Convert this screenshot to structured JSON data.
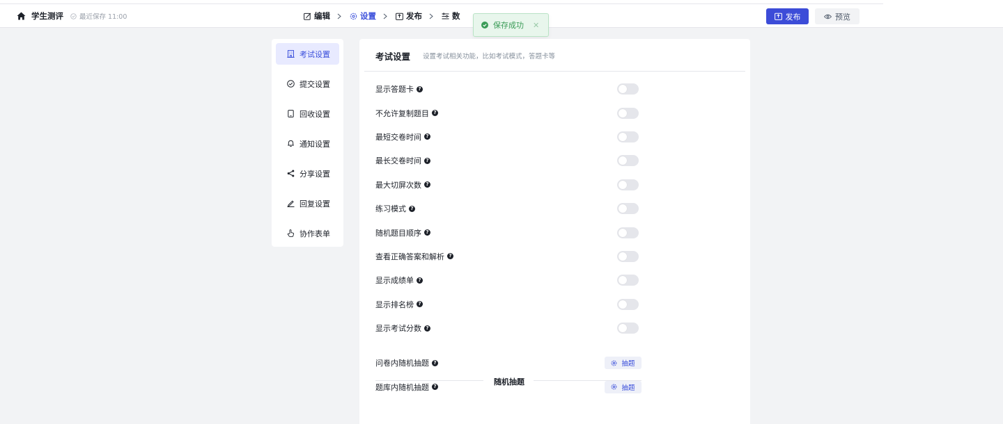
{
  "header": {
    "title": "学生测评",
    "save_status": "最近保存 11:00",
    "steps": [
      {
        "label": "编辑",
        "icon": "edit-icon"
      },
      {
        "label": "设置",
        "icon": "gear-icon"
      },
      {
        "label": "发布",
        "icon": "share-box-icon"
      },
      {
        "label": "数",
        "icon": "list-settings-icon"
      }
    ],
    "publish_label": "发布",
    "preview_label": "预览"
  },
  "toast": {
    "message": "保存成功"
  },
  "sidebar": {
    "items": [
      {
        "label": "考试设置",
        "icon": "building-icon"
      },
      {
        "label": "提交设置",
        "icon": "check-circle-icon"
      },
      {
        "label": "回收设置",
        "icon": "tablet-icon"
      },
      {
        "label": "通知设置",
        "icon": "bell-icon"
      },
      {
        "label": "分享设置",
        "icon": "share-icon"
      },
      {
        "label": "回复设置",
        "icon": "pen-icon"
      },
      {
        "label": "协作表单",
        "icon": "hand-pointer-icon"
      }
    ]
  },
  "panel": {
    "title": "考试设置",
    "subtitle": "设置考试相关功能，比如考试模式，答题卡等",
    "settings": [
      {
        "label": "显示答题卡",
        "enabled": false
      },
      {
        "label": "不允许复制题目",
        "enabled": false
      },
      {
        "label": "最短交卷时间",
        "enabled": false
      },
      {
        "label": "最长交卷时间",
        "enabled": false
      },
      {
        "label": "最大切屏次数",
        "enabled": false
      },
      {
        "label": "练习模式",
        "enabled": false
      },
      {
        "label": "随机题目顺序",
        "enabled": false
      },
      {
        "label": "查看正确答案和解析",
        "enabled": false
      },
      {
        "label": "显示成绩单",
        "enabled": false
      },
      {
        "label": "显示排名榜",
        "enabled": false
      },
      {
        "label": "显示考试分数",
        "enabled": false
      }
    ],
    "random_section": {
      "title": "随机抽题",
      "items": [
        {
          "label": "问卷内随机抽题",
          "button": "抽题"
        },
        {
          "label": "题库内随机抽题",
          "button": "抽题"
        }
      ]
    }
  },
  "colors": {
    "accent": "#3c4cd8",
    "success": "#3a9b57",
    "background": "#f2f3f5"
  }
}
